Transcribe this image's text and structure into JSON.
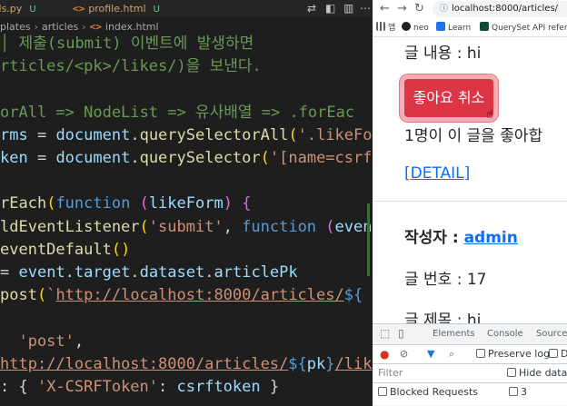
{
  "editor": {
    "tabs": [
      {
        "label": "rls.py",
        "badge": "U",
        "icon": "python-icon"
      },
      {
        "label": "profile.html",
        "badge": "U",
        "icon": "html-icon"
      }
    ],
    "breadcrumb": [
      "plates",
      "articles",
      "index.html"
    ],
    "lines": [
      [
        {
          "t": "│ 제출(submit) 이벤트에 발생하면",
          "c": "c-com"
        }
      ],
      [
        {
          "t": "rticles/<pk>/likes/)을 보낸다.",
          "c": "c-com"
        }
      ],
      [],
      [
        {
          "t": "orAll => NodeList => 유사배열 => .forEac",
          "c": "c-com"
        }
      ],
      [
        {
          "t": "rms",
          "c": "c-var"
        },
        {
          "t": " = ",
          "c": "c-op"
        },
        {
          "t": "document",
          "c": "c-var"
        },
        {
          "t": ".",
          "c": "c-pun"
        },
        {
          "t": "querySelectorAll",
          "c": "c-fn"
        },
        {
          "t": "(",
          "c": "c-brk"
        },
        {
          "t": "'.likeFo",
          "c": "c-str"
        }
      ],
      [
        {
          "t": "ken",
          "c": "c-var"
        },
        {
          "t": " = ",
          "c": "c-op"
        },
        {
          "t": "document",
          "c": "c-var"
        },
        {
          "t": ".",
          "c": "c-pun"
        },
        {
          "t": "querySelector",
          "c": "c-fn"
        },
        {
          "t": "(",
          "c": "c-brk"
        },
        {
          "t": "'[name=csrf",
          "c": "c-str"
        }
      ],
      [],
      [
        {
          "t": "rEach",
          "c": "c-fn"
        },
        {
          "t": "(",
          "c": "c-brk"
        },
        {
          "t": "function",
          "c": "c-kw"
        },
        {
          "t": " (",
          "c": "c-brk2"
        },
        {
          "t": "likeForm",
          "c": "c-prm"
        },
        {
          "t": ") ",
          "c": "c-brk2"
        },
        {
          "t": "{",
          "c": "c-brk2"
        }
      ],
      [
        {
          "t": "ldEventListener",
          "c": "c-fn"
        },
        {
          "t": "(",
          "c": "c-brk"
        },
        {
          "t": "'submit'",
          "c": "c-str"
        },
        {
          "t": ", ",
          "c": "c-pun"
        },
        {
          "t": "function",
          "c": "c-kw"
        },
        {
          "t": " (",
          "c": "c-brk2"
        },
        {
          "t": "even",
          "c": "c-prm"
        }
      ],
      [
        {
          "t": "eventDefault",
          "c": "c-fn"
        },
        {
          "t": "()",
          "c": "c-brk"
        }
      ],
      [
        {
          "t": "= ",
          "c": "c-op"
        },
        {
          "t": "event",
          "c": "c-var"
        },
        {
          "t": ".",
          "c": "c-pun"
        },
        {
          "t": "target",
          "c": "c-var"
        },
        {
          "t": ".",
          "c": "c-pun"
        },
        {
          "t": "dataset",
          "c": "c-var"
        },
        {
          "t": ".",
          "c": "c-pun"
        },
        {
          "t": "articlePk",
          "c": "c-var"
        }
      ],
      [
        {
          "t": "post",
          "c": "c-fn"
        },
        {
          "t": "(",
          "c": "c-brk"
        },
        {
          "t": "`",
          "c": "c-str"
        },
        {
          "t": "http://localhost:8000/articles/",
          "c": "c-url"
        },
        {
          "t": "${",
          "c": "c-kw"
        }
      ],
      [],
      [
        {
          "t": "  'post'",
          "c": "c-str"
        },
        {
          "t": ",",
          "c": "c-pun"
        }
      ],
      [
        {
          "t": "http://localhost:8000/articles/",
          "c": "c-url"
        },
        {
          "t": "${",
          "c": "c-kw"
        },
        {
          "t": "pk",
          "c": "c-var"
        },
        {
          "t": "}",
          "c": "c-kw"
        },
        {
          "t": "/lik",
          "c": "c-url"
        }
      ],
      [
        {
          "t": ": { ",
          "c": "c-pun"
        },
        {
          "t": "'X-CSRFToken'",
          "c": "c-str"
        },
        {
          "t": ": ",
          "c": "c-pun"
        },
        {
          "t": "csrftoken",
          "c": "c-var"
        },
        {
          "t": " }",
          "c": "c-pun"
        }
      ]
    ]
  },
  "browser": {
    "url": "localhost:8000/articles/",
    "bookmarks": [
      {
        "label": "앱",
        "color": "#5f6368"
      },
      {
        "label": "neo",
        "color": "#202124"
      },
      {
        "label": "Learn",
        "color": "#1a73e8"
      },
      {
        "label": "QuerySet API refer...",
        "color": "#0c4b33"
      }
    ],
    "page": {
      "content_line": "글 내용 : hi",
      "unlike_button": "좋아요 취소",
      "like_count_text": "1명이 이 글을 좋아합",
      "detail_link": "[DETAIL]",
      "author_label": "작성자 : ",
      "author_name": "admin",
      "number_line": "글 번호 : 17",
      "title_line": "글 제목 : hi"
    },
    "devtools": {
      "tabs": [
        "Elements",
        "Console",
        "Sources"
      ],
      "preserve_log": "Preserve log",
      "disable_cache": "D",
      "filter_placeholder": "Filter",
      "hide_data": "Hide data U",
      "blocked_requests": "Blocked Requests",
      "third_party": "3"
    }
  }
}
